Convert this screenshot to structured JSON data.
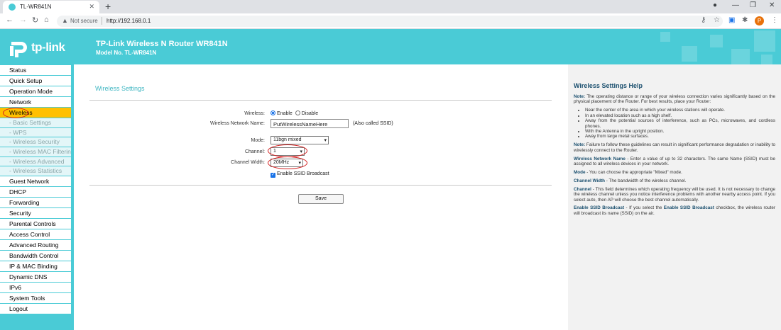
{
  "browser": {
    "tab_title": "TL-WR841N",
    "not_secure": "Not secure",
    "url": "http://192.168.0.1",
    "profile_initial": "P"
  },
  "header": {
    "logo_text": "tp-link",
    "product": "TP-Link Wireless N Router WR841N",
    "model": "Model No. TL-WR841N"
  },
  "sidebar": {
    "items": [
      {
        "label": "Status",
        "type": "main"
      },
      {
        "label": "Quick Setup",
        "type": "main"
      },
      {
        "label": "Operation Mode",
        "type": "main"
      },
      {
        "label": "Network",
        "type": "main"
      },
      {
        "label": "Wireless",
        "type": "active"
      },
      {
        "label": "- Basic Settings",
        "type": "sub"
      },
      {
        "label": "- WPS",
        "type": "sub"
      },
      {
        "label": "- Wireless Security",
        "type": "sub"
      },
      {
        "label": "- Wireless MAC Filtering",
        "type": "sub"
      },
      {
        "label": "- Wireless Advanced",
        "type": "sub"
      },
      {
        "label": "- Wireless Statistics",
        "type": "sub"
      },
      {
        "label": "Guest Network",
        "type": "main"
      },
      {
        "label": "DHCP",
        "type": "main"
      },
      {
        "label": "Forwarding",
        "type": "main"
      },
      {
        "label": "Security",
        "type": "main"
      },
      {
        "label": "Parental Controls",
        "type": "main"
      },
      {
        "label": "Access Control",
        "type": "main"
      },
      {
        "label": "Advanced Routing",
        "type": "main"
      },
      {
        "label": "Bandwidth Control",
        "type": "main"
      },
      {
        "label": "IP & MAC Binding",
        "type": "main"
      },
      {
        "label": "Dynamic DNS",
        "type": "main"
      },
      {
        "label": "IPv6",
        "type": "main"
      },
      {
        "label": "System Tools",
        "type": "main"
      },
      {
        "label": "Logout",
        "type": "main"
      }
    ]
  },
  "form": {
    "title": "Wireless Settings",
    "wireless_label": "Wireless:",
    "enable": "Enable",
    "disable": "Disable",
    "ssid_label": "Wireless Network Name:",
    "ssid_value": "PutWirelessNameHere",
    "ssid_hint": "(Also called SSID)",
    "mode_label": "Mode:",
    "mode_value": "11bgn mixed",
    "channel_label": "Channel:",
    "channel_value": "1",
    "width_label": "Channel Width:",
    "width_value": "20MHz",
    "broadcast_label": "Enable SSID Broadcast",
    "save": "Save"
  },
  "help": {
    "title": "Wireless Settings Help",
    "note1_head": "Note:",
    "note1": " The operating distance or range of your wireless connection varies significantly based on the physical placement of the Router. For best results, place your Router:",
    "bullets": [
      "Near the center of the area in which your wireless stations will operate.",
      "In an elevated location such as a high shelf.",
      "Away from the potential sources of interference, such as PCs, microwaves, and cordless phones.",
      "With the Antenna in the upright position.",
      "Away from large metal surfaces."
    ],
    "note2_head": "Note:",
    "note2": " Failure to follow these guidelines can result in significant performance degradation or inability to wirelessly connect to the Router.",
    "ssid_head": "Wireless Network Name",
    "ssid_text": " - Enter a value of up to 32 characters. The same Name (SSID) must be assigned to all wireless devices in your network.",
    "mode_head": "Mode",
    "mode_text": " - You can choose the appropriate \"Mixed\" mode.",
    "width_head": "Channel Width",
    "width_text": " - The bandwidth of the wireless channel.",
    "channel_head": "Channel",
    "channel_text": " - This field determines which operating frequency will be used. It is not necessary to change the wireless channel unless you notice interference problems with another nearby access point. If you select auto, then AP will choose the best channel automatically.",
    "bcast_head": "Enable SSID Broadcast",
    "bcast_text1": " - If you select the ",
    "bcast_bold": "Enable SSID Broadcast",
    "bcast_text2": " checkbox, the wireless router will broadcast its name (SSID) on the air."
  }
}
